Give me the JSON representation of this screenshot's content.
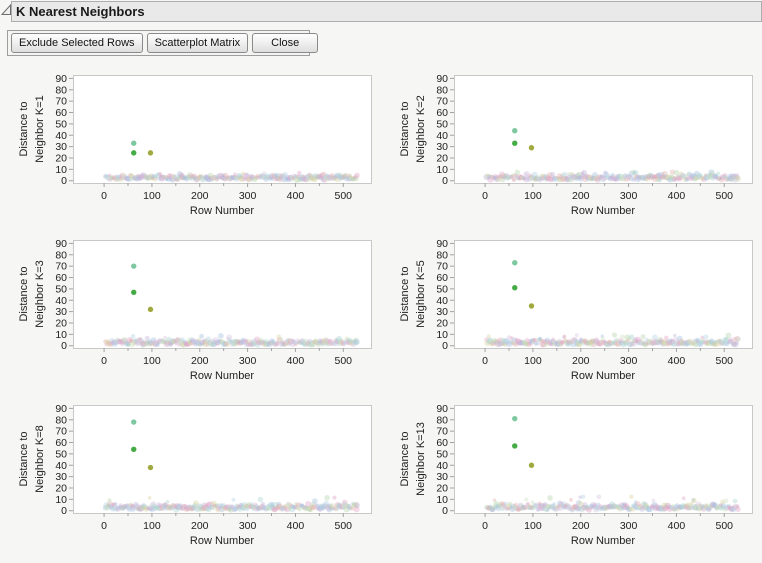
{
  "window": {
    "title": "K Nearest Neighbors"
  },
  "header": {
    "disclosure_icon": "open-triangle"
  },
  "toolbar": {
    "buttons": [
      {
        "label": "Exclude Selected Rows"
      },
      {
        "label": "Scatterplot Matrix"
      },
      {
        "label": "Close"
      }
    ]
  },
  "colors": {
    "background": "#f6f6f5",
    "header_bg": "#e9e9e9",
    "header_border": "#adadad",
    "plot_bg": "#ffffff",
    "plot_frame": "#c8c8c8",
    "axis": "#a2a2a2",
    "outlier_teal": "#76c59a",
    "outlier_green": "#3ba63b",
    "outlier_olive": "#9ba433",
    "baseline_palette": [
      "#dfa8c8",
      "#dfa8c8",
      "#e4b1b1",
      "#a8c0df",
      "#a8c0df",
      "#b7d3e6",
      "#b9d6ae",
      "#d9d3a2",
      "#c0b4dc",
      "#abd6cf",
      "#d8c9e2",
      "#cfe0c3"
    ],
    "baseline_opacity": 0.42
  },
  "chart_data": [
    {
      "type": "scatter",
      "k": 1,
      "ylabel_lines": [
        "Distance to",
        "Neighbor K=1"
      ],
      "xlabel": "Row Number",
      "xlim": [
        -65,
        558
      ],
      "ylim": [
        -2,
        93
      ],
      "xticks": [
        0,
        100,
        200,
        300,
        400,
        500
      ],
      "yticks": [
        0,
        10,
        20,
        30,
        40,
        50,
        60,
        70,
        80,
        90
      ],
      "outliers": [
        {
          "x": 62,
          "y": 33,
          "color_key": "outlier_teal"
        },
        {
          "x": 62,
          "y": 24.5,
          "color_key": "outlier_green"
        },
        {
          "x": 97,
          "y": 24.5,
          "color_key": "outlier_olive"
        }
      ],
      "baseline": {
        "n": 310,
        "x_min": 2,
        "x_max": 530,
        "scale": 0.75,
        "spike_max": 7,
        "seed": 101
      }
    },
    {
      "type": "scatter",
      "k": 2,
      "ylabel_lines": [
        "Distance to",
        "Neighbor K=2"
      ],
      "xlabel": "Row Number",
      "xlim": [
        -65,
        558
      ],
      "ylim": [
        -2,
        93
      ],
      "xticks": [
        0,
        100,
        200,
        300,
        400,
        500
      ],
      "yticks": [
        0,
        10,
        20,
        30,
        40,
        50,
        60,
        70,
        80,
        90
      ],
      "outliers": [
        {
          "x": 62,
          "y": 44,
          "color_key": "outlier_teal"
        },
        {
          "x": 62,
          "y": 33,
          "color_key": "outlier_green"
        },
        {
          "x": 97,
          "y": 29,
          "color_key": "outlier_olive"
        }
      ],
      "baseline": {
        "n": 310,
        "x_min": 2,
        "x_max": 530,
        "scale": 0.8,
        "spike_max": 8,
        "seed": 102
      }
    },
    {
      "type": "scatter",
      "k": 3,
      "ylabel_lines": [
        "Distance to",
        "Neighbor K=3"
      ],
      "xlabel": "Row Number",
      "xlim": [
        -65,
        558
      ],
      "ylim": [
        -2,
        93
      ],
      "xticks": [
        0,
        100,
        200,
        300,
        400,
        500
      ],
      "yticks": [
        0,
        10,
        20,
        30,
        40,
        50,
        60,
        70,
        80,
        90
      ],
      "outliers": [
        {
          "x": 62,
          "y": 70,
          "color_key": "outlier_teal"
        },
        {
          "x": 62,
          "y": 47,
          "color_key": "outlier_green"
        },
        {
          "x": 97,
          "y": 32,
          "color_key": "outlier_olive"
        }
      ],
      "baseline": {
        "n": 310,
        "x_min": 2,
        "x_max": 530,
        "scale": 0.85,
        "spike_max": 9,
        "seed": 103
      }
    },
    {
      "type": "scatter",
      "k": 5,
      "ylabel_lines": [
        "Distance to",
        "Neighbor K=5"
      ],
      "xlabel": "Row Number",
      "xlim": [
        -65,
        558
      ],
      "ylim": [
        -2,
        93
      ],
      "xticks": [
        0,
        100,
        200,
        300,
        400,
        500
      ],
      "yticks": [
        0,
        10,
        20,
        30,
        40,
        50,
        60,
        70,
        80,
        90
      ],
      "outliers": [
        {
          "x": 62,
          "y": 73,
          "color_key": "outlier_teal"
        },
        {
          "x": 62,
          "y": 51,
          "color_key": "outlier_green"
        },
        {
          "x": 97,
          "y": 35,
          "color_key": "outlier_olive"
        }
      ],
      "baseline": {
        "n": 310,
        "x_min": 2,
        "x_max": 530,
        "scale": 1.0,
        "spike_max": 10,
        "seed": 104
      }
    },
    {
      "type": "scatter",
      "k": 8,
      "ylabel_lines": [
        "Distance to",
        "Neighbor K=8"
      ],
      "xlabel": "Row Number",
      "xlim": [
        -65,
        558
      ],
      "ylim": [
        -2,
        93
      ],
      "xticks": [
        0,
        100,
        200,
        300,
        400,
        500
      ],
      "yticks": [
        0,
        10,
        20,
        30,
        40,
        50,
        60,
        70,
        80,
        90
      ],
      "outliers": [
        {
          "x": 62,
          "y": 78,
          "color_key": "outlier_teal"
        },
        {
          "x": 62,
          "y": 54,
          "color_key": "outlier_green"
        },
        {
          "x": 97,
          "y": 38,
          "color_key": "outlier_olive"
        }
      ],
      "baseline": {
        "n": 310,
        "x_min": 2,
        "x_max": 530,
        "scale": 1.1,
        "spike_max": 12,
        "seed": 105
      }
    },
    {
      "type": "scatter",
      "k": 13,
      "ylabel_lines": [
        "Distance to",
        "Neighbor K=13"
      ],
      "xlabel": "Row Number",
      "xlim": [
        -65,
        558
      ],
      "ylim": [
        -2,
        93
      ],
      "xticks": [
        0,
        100,
        200,
        300,
        400,
        500
      ],
      "yticks": [
        0,
        10,
        20,
        30,
        40,
        50,
        60,
        70,
        80,
        90
      ],
      "outliers": [
        {
          "x": 62,
          "y": 81,
          "color_key": "outlier_teal"
        },
        {
          "x": 62,
          "y": 57,
          "color_key": "outlier_green"
        },
        {
          "x": 97,
          "y": 40,
          "color_key": "outlier_olive"
        }
      ],
      "baseline": {
        "n": 310,
        "x_min": 2,
        "x_max": 530,
        "scale": 1.2,
        "spike_max": 13,
        "seed": 106
      }
    }
  ]
}
